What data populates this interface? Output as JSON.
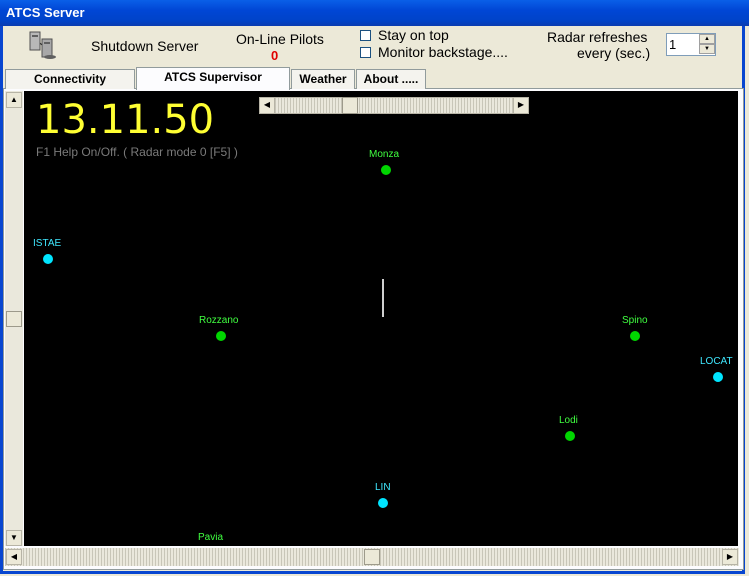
{
  "window": {
    "title": "ATCS Server"
  },
  "toolbar": {
    "shutdown_label": "Shutdown Server",
    "pilots_label": "On-Line Pilots",
    "pilots_count": "0",
    "stay_on_top_label": "Stay on top",
    "stay_on_top_checked": false,
    "monitor_label": "Monitor backstage....",
    "monitor_checked": false,
    "radar_refresh_label_1": "Radar refreshes",
    "radar_refresh_label_2": "every (sec.)",
    "radar_refresh_value": "1"
  },
  "tabs": [
    {
      "label": "Connectivity",
      "active": false
    },
    {
      "label": "ATCS Supervisor",
      "active": true
    },
    {
      "label": "Weather",
      "active": false
    },
    {
      "label": "About .....",
      "active": false
    }
  ],
  "radar": {
    "clock": "13.11.50",
    "help_text": "F1 Help On/Off.  ( Radar mode 0 [F5] )",
    "fixes": [
      {
        "name": "Monza",
        "kind": "green"
      },
      {
        "name": "ISTAE",
        "kind": "cyan"
      },
      {
        "name": "Rozzano",
        "kind": "green"
      },
      {
        "name": "Spino",
        "kind": "green"
      },
      {
        "name": "LOCAT",
        "kind": "cyan"
      },
      {
        "name": "Lodi",
        "kind": "green"
      },
      {
        "name": "LIN",
        "kind": "cyan"
      },
      {
        "name": "Pavia",
        "kind": "green"
      }
    ]
  },
  "colors": {
    "title_bar": "#0046D5",
    "radar_background": "#000000",
    "clock": "#FFFF33",
    "fix_green": "#00D600",
    "fix_cyan": "#00E5FF",
    "pilots_count": "#E00000"
  }
}
